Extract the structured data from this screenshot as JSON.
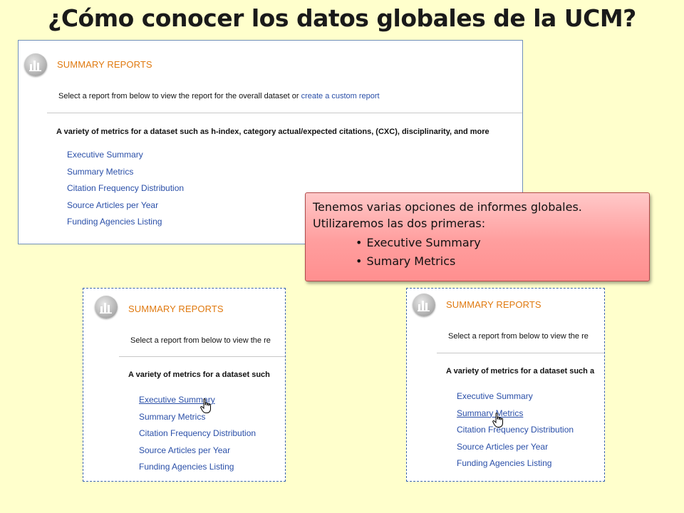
{
  "slide": {
    "title": "¿Cómo conocer los datos globales de la UCM?"
  },
  "panel_main": {
    "header": "SUMMARY REPORTS",
    "select_text": "Select a report from below to view the report for the overall dataset or ",
    "custom_link": "create a custom report",
    "metrics_desc": "A variety of metrics for a dataset such as h-index, category actual/expected citations, (CXC), disciplinarity, and more",
    "reports": [
      "Executive Summary",
      "Summary Metrics",
      "Citation Frequency Distribution",
      "Source Articles per Year",
      "Funding Agencies Listing"
    ]
  },
  "panel_left": {
    "header": "SUMMARY REPORTS",
    "select_text": "Select a report from below to view the re",
    "metrics_desc": "A variety of metrics for a dataset such",
    "reports": [
      "Executive Summary",
      "Summary Metrics",
      "Citation Frequency Distribution",
      "Source Articles per Year",
      "Funding Agencies Listing"
    ]
  },
  "panel_right": {
    "header": "SUMMARY REPORTS",
    "select_text": "Select a report from below to view the re",
    "metrics_desc": "A variety of metrics for a dataset such a",
    "reports": [
      "Executive Summary",
      "Summary Metrics",
      "Citation Frequency Distribution",
      "Source Articles per Year",
      "Funding Agencies Listing"
    ]
  },
  "callout": {
    "line1": "Tenemos varias opciones de informes globales.",
    "line2": "Utilizaremos las dos primeras:",
    "bullets": [
      "Executive Summary",
      "Sumary Metrics"
    ]
  },
  "icons": {
    "report_icon": "bar-chart-icon",
    "cursor_icon": "hand-pointer-icon"
  },
  "colors": {
    "background": "#ffffcc",
    "header_orange": "#e07a10",
    "link_blue": "#2a4fa8",
    "callout_fill": "#ff9e9e"
  }
}
